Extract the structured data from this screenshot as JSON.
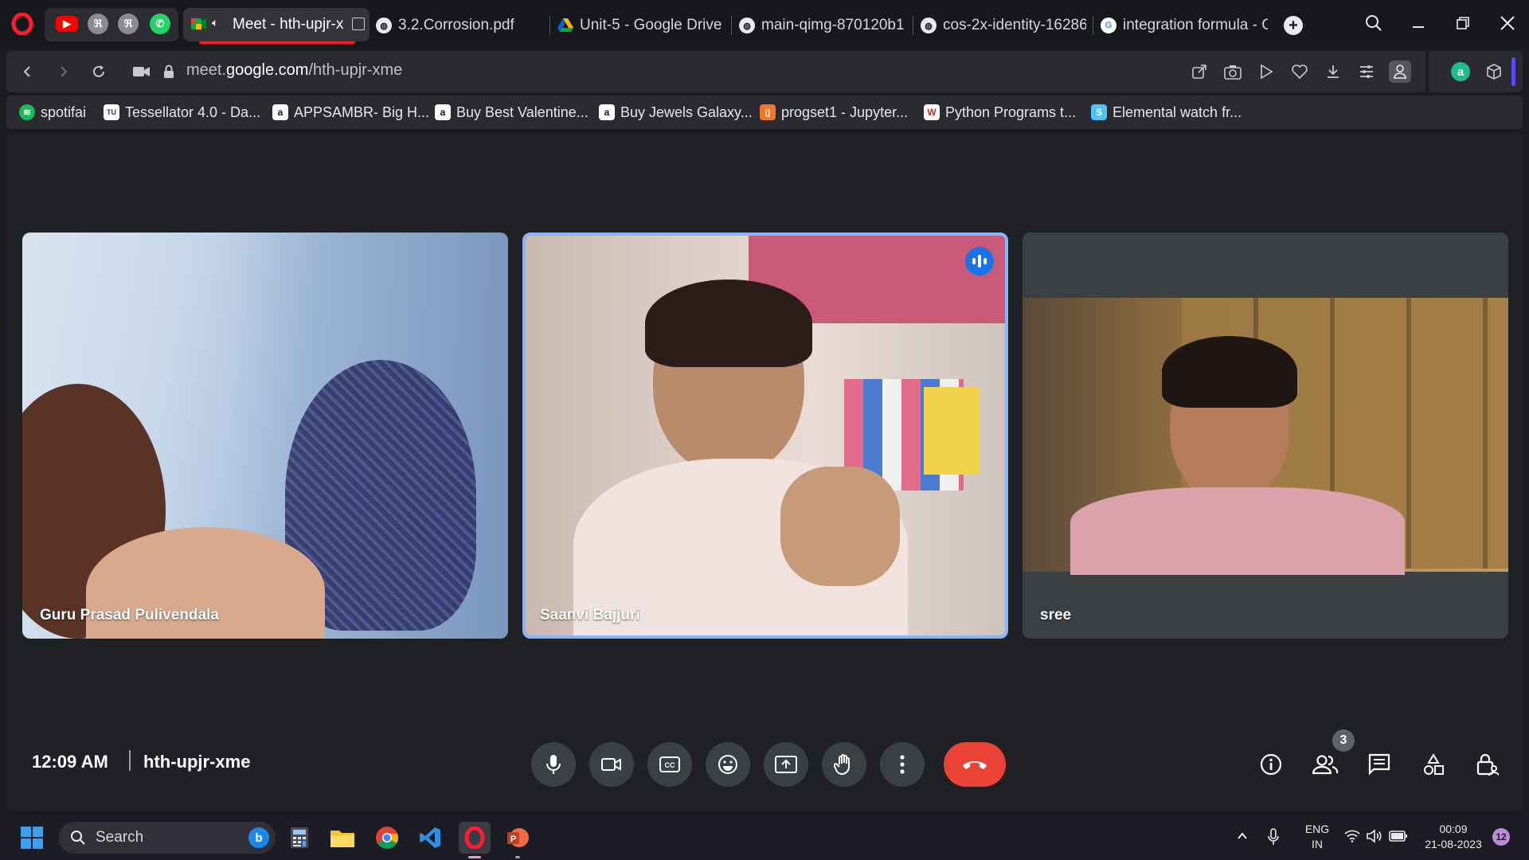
{
  "tabs": {
    "active_title": "Meet - hth-upjr-x",
    "items": [
      {
        "title": "3.2.Corrosion.pdf"
      },
      {
        "title": "Unit-5 - Google Drive"
      },
      {
        "title": "main-qimg-870120b1"
      },
      {
        "title": "cos-2x-identity-16286"
      },
      {
        "title": "integration formula - G"
      }
    ],
    "new_tab": "+"
  },
  "address": {
    "url_prefix": "meet.",
    "url_domain": "google.com",
    "url_path": "/hth-upjr-xme"
  },
  "bookmarks": [
    {
      "label": "spotifai",
      "color": "#1db954",
      "glyph": "≋"
    },
    {
      "label": "Tessellator 4.0 - Da...",
      "color": "#ffffff",
      "glyph": "TU"
    },
    {
      "label": "APPSAMBR- Big H...",
      "color": "#ffffff",
      "glyph": "a"
    },
    {
      "label": "Buy Best Valentine...",
      "color": "#ffffff",
      "glyph": "a"
    },
    {
      "label": "Buy Jewels Galaxy...",
      "color": "#ffffff",
      "glyph": "a"
    },
    {
      "label": "progset1 - Jupyter...",
      "color": "#f37626",
      "glyph": "▯"
    },
    {
      "label": "Python Programs t...",
      "color": "#ffffff",
      "glyph": "W"
    },
    {
      "label": "Elemental watch fr...",
      "color": "#4fc3f7",
      "glyph": "S"
    }
  ],
  "participants": [
    {
      "name": "Guru Prasad Pulivendala"
    },
    {
      "name": "Saanvi Bajjuri",
      "speaking": true
    },
    {
      "name": "sree"
    }
  ],
  "meeting": {
    "time": "12:09 AM",
    "code": "hth-upjr-xme",
    "people_count": "3"
  },
  "taskbar": {
    "search_label": "Search",
    "lang_top": "ENG",
    "lang_bottom": "IN",
    "clock_time": "00:09",
    "clock_date": "21-08-2023",
    "notifications": "12"
  },
  "colors": {
    "accent": "#1a73e8",
    "end_call": "#ea4335",
    "opera_red": "#ff1b2d"
  }
}
